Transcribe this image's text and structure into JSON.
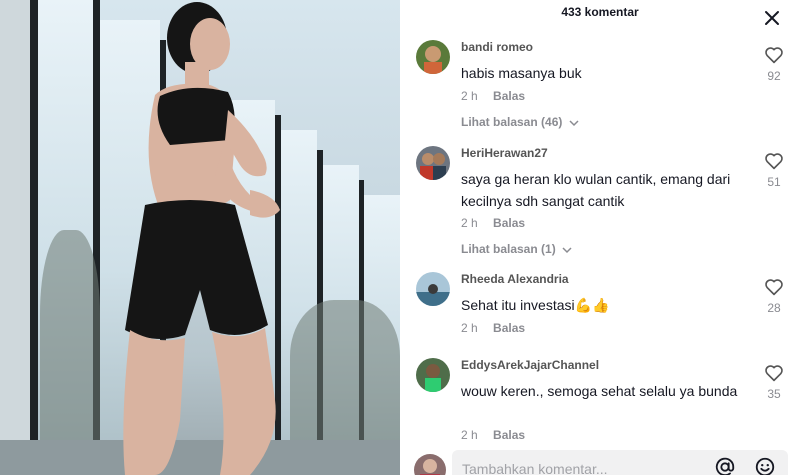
{
  "header": {
    "title": "433 komentar"
  },
  "comments": [
    {
      "user": "bandi romeo",
      "text": "habis masanya buk",
      "time": "2 h",
      "reply": "Balas",
      "likes": "92",
      "more": "Lihat balasan (46)"
    },
    {
      "user": "HeriHerawan27",
      "text": "saya ga heran klo wulan cantik, emang dari kecilnya sdh sangat cantik",
      "time": "2 h",
      "reply": "Balas",
      "likes": "51",
      "more": "Lihat balasan (1)"
    },
    {
      "user": "Rheeda Alexandria",
      "text": "Sehat itu investasi💪👍",
      "time": "2 h",
      "reply": "Balas",
      "likes": "28"
    },
    {
      "user": "EddysArekJajarChannel",
      "text": "wouw keren., semoga sehat selalu ya bunda",
      "time": "2 h",
      "reply": "Balas",
      "likes": "35"
    }
  ],
  "input": {
    "placeholder": "Tambahkan komentar..."
  },
  "icons": {
    "close": "close-icon",
    "like": "heart-outline-icon",
    "mention": "at-sign-icon",
    "emoji": "emoji-icon",
    "chevron": "chevron-down-icon"
  },
  "colors": {
    "text": "#161823",
    "muted": "#8a8b91",
    "input_bg": "#f1f1f2"
  }
}
